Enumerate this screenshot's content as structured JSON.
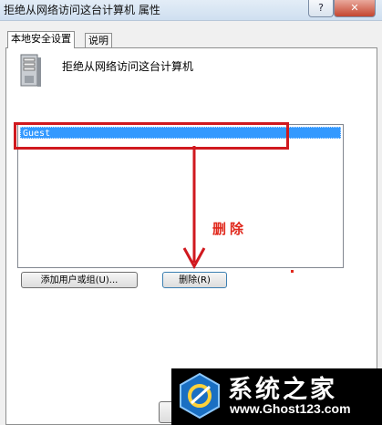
{
  "window": {
    "title": "拒绝从网络访问这台计算机 属性",
    "help_button": "?",
    "close_button": "✕"
  },
  "tabs": [
    {
      "label": "本地安全设置",
      "active": true
    },
    {
      "label": "说明",
      "active": false
    }
  ],
  "policy": {
    "name": "拒绝从网络访问这台计算机",
    "icon": "server-icon"
  },
  "accounts_list": {
    "items": [
      "Guest"
    ],
    "selected": "Guest"
  },
  "buttons": {
    "add": "添加用户或组(U)...",
    "remove": "删除(R)"
  },
  "annotation": {
    "label": "删除",
    "color": "#e0281c"
  },
  "watermark": {
    "brand": "系统之家",
    "url": "www.Ghost123.com"
  }
}
